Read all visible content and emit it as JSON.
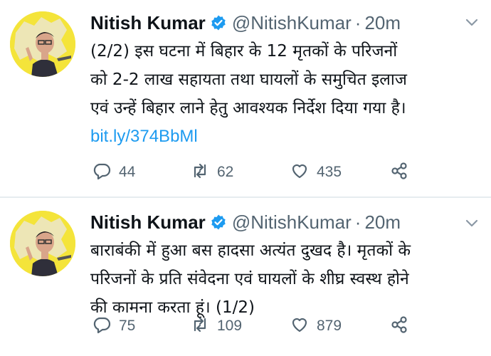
{
  "colors": {
    "accent": "#1d9bf0",
    "text": "#0f1419",
    "muted": "#536471",
    "avatar_bg": "#f4e43a",
    "divider": "#e6ecf0"
  },
  "tweets": [
    {
      "name": "Nitish Kumar",
      "handle": "@NitishKumar",
      "separator": "·",
      "time": "20m",
      "lines": [
        "(2/2) इस घटना में बिहार के 12 मृतकों के परिजनों",
        "को 2-2 लाख सहायता तथा घायलों के समुचित इलाज",
        "एवं उन्हें बिहार लाने हेतु आवश्यक निर्देश दिया गया है।"
      ],
      "link": "bit.ly/374BbMl",
      "replies": "44",
      "retweets": "62",
      "likes": "435",
      "icons": [
        "verified-icon",
        "more-icon",
        "reply-icon",
        "retweet-icon",
        "like-icon",
        "share-icon"
      ]
    },
    {
      "name": "Nitish Kumar",
      "handle": "@NitishKumar",
      "separator": "·",
      "time": "20m",
      "lines": [
        "बाराबंकी में हुआ बस हादसा अत्यंत दुखद है। मृतकों के",
        "परिजनों के प्रति संवेदना एवं घायलों के शीघ्र स्वस्थ होने",
        "की कामना करता हूं। (1/2)"
      ],
      "replies": "75",
      "retweets": "109",
      "likes": "879",
      "icons": [
        "verified-icon",
        "more-icon",
        "reply-icon",
        "retweet-icon",
        "like-icon",
        "share-icon"
      ]
    }
  ]
}
